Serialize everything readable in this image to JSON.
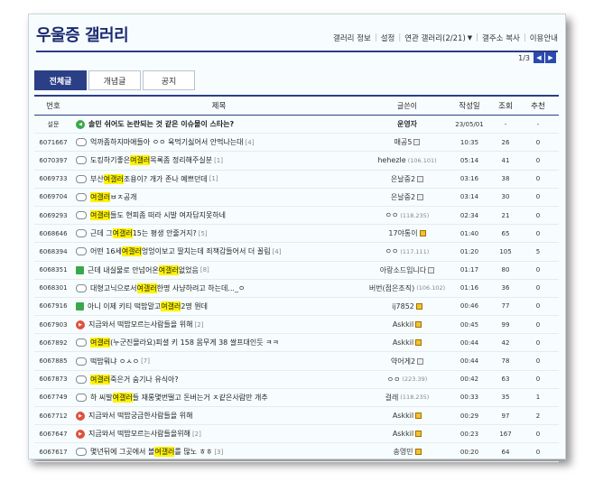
{
  "gallery": {
    "title": "우울증 갤러리"
  },
  "nav": {
    "items": [
      {
        "label": "갤러리 정보"
      },
      {
        "label": "설정"
      },
      {
        "label": "연관 갤러리(2/21)",
        "has_dropdown": true
      },
      {
        "label": "갤주소 복사"
      },
      {
        "label": "이용안내"
      }
    ]
  },
  "pager": {
    "text": "1/3",
    "prev_icon": "triangle-left",
    "next_icon": "triangle-right"
  },
  "tabs": [
    {
      "label": "전체글",
      "active": true
    },
    {
      "label": "개념글",
      "active": false
    },
    {
      "label": "공지",
      "active": false
    }
  ],
  "columns": {
    "no": "번호",
    "title": "제목",
    "user": "글쓴이",
    "date": "작성일",
    "views": "조회",
    "rec": "추천"
  },
  "colors": {
    "accent": "#2b3f87",
    "highlight": "#fff200",
    "speaker": "#3aa84a",
    "play": "#e0503c"
  },
  "rows": [
    {
      "no": "설문",
      "icon": "speaker",
      "parts": [
        "솔민 쉬어도 논란되는 것 같은 이슈몰이 스타는?"
      ],
      "count": "",
      "user": "운영자",
      "ip": "",
      "badge": "",
      "date": "23/05/01",
      "views": "-",
      "rec": "-",
      "notice": true
    },
    {
      "no": "6071667",
      "icon": "chat",
      "parts": [
        "억까좀하지마애들아 ㅇㅇ 육먹기싫어서 안먹나는대"
      ],
      "count": "[4]",
      "user": "매공5",
      "ip": "",
      "badge": "gray",
      "date": "10:35",
      "views": "26",
      "rec": "0"
    },
    {
      "no": "6070397",
      "icon": "chat",
      "parts": [
        "도킹하기좋은",
        "여갤러",
        "목록좀 정리해주실분"
      ],
      "count": "[1]",
      "user": "hehezle",
      "ip": "(106.101)",
      "badge": "",
      "date": "05:14",
      "views": "41",
      "rec": "0"
    },
    {
      "no": "6069733",
      "icon": "chat",
      "parts": [
        "부산",
        "여갤러",
        " 조용이? 개가 존나 예쁘던데"
      ],
      "count": "[1]",
      "user": "은날중2",
      "ip": "",
      "badge": "gray",
      "date": "03:16",
      "views": "38",
      "rec": "0"
    },
    {
      "no": "6069704",
      "icon": "chat",
      "parts": [
        "",
        "여갤러",
        " ㅂㅈ공개"
      ],
      "count": "",
      "user": "은날중2",
      "ip": "",
      "badge": "gray",
      "date": "03:14",
      "views": "30",
      "rec": "0"
    },
    {
      "no": "6069293",
      "icon": "chat",
      "parts": [
        "",
        "여갤러",
        "들도 현피좀 떠라 시발 여자답지못하네"
      ],
      "count": "",
      "user": "ㅇㅇ",
      "ip": "(118.235)",
      "badge": "",
      "date": "02:34",
      "views": "21",
      "rec": "0"
    },
    {
      "no": "6068646",
      "icon": "chat",
      "parts": [
        "근데 그 ",
        "여갤러",
        " 15는 평생 안줄거지?"
      ],
      "count": "[5]",
      "user": "17야통이",
      "ip": "",
      "badge": "gold",
      "date": "01:40",
      "views": "65",
      "rec": "0"
    },
    {
      "no": "6068394",
      "icon": "chat",
      "parts": [
        "어떤 16세",
        "여갤러",
        " 엉엉이보고 딸치는데 죄책감들어서 더 꼴림"
      ],
      "count": "[4]",
      "user": "ㅇㅇ",
      "ip": "(117.111)",
      "badge": "",
      "date": "01:20",
      "views": "105",
      "rec": "5"
    },
    {
      "no": "6068351",
      "icon": "photo",
      "parts": [
        "근데 내실물로 안넘어온 ",
        "여갤러",
        "없었음"
      ],
      "count": "[8]",
      "user": "아랑소드입니다",
      "ip": "",
      "badge": "gray",
      "date": "01:17",
      "views": "80",
      "rec": "0"
    },
    {
      "no": "6068301",
      "icon": "chat",
      "parts": [
        "대형고닉으로서 ",
        "여갤러",
        " 한명 사냥하려고 하는데..._ㅇ"
      ],
      "count": "",
      "user": "버번(점은조직)",
      "ip": "(106.102)",
      "badge": "",
      "date": "01:16",
      "views": "36",
      "rec": "0"
    },
    {
      "no": "6067916",
      "icon": "photo",
      "parts": [
        "아니 이제 키티 떡밥말고 ",
        "여갤러",
        " 2명 뭔데"
      ],
      "count": "",
      "user": "ij7852",
      "ip": "",
      "badge": "gold",
      "date": "00:46",
      "views": "77",
      "rec": "0"
    },
    {
      "no": "6067903",
      "icon": "play",
      "parts": [
        "지금와서 떡밥모르는사람들을 위해"
      ],
      "count": "[2]",
      "user": "Askkil",
      "ip": "",
      "badge": "gold",
      "date": "00:45",
      "views": "99",
      "rec": "0"
    },
    {
      "no": "6067892",
      "icon": "chat",
      "parts": [
        "",
        "여갤러",
        "(누군진몰라요)피셜 키 158 몸무게 38 쌀프대인듯 ㅋㅋ"
      ],
      "count": "",
      "user": "Askkil",
      "ip": "",
      "badge": "gold",
      "date": "00:44",
      "views": "42",
      "rec": "0"
    },
    {
      "no": "6067885",
      "icon": "chat",
      "parts": [
        "떡밥뭐냐 ㅇㅅㅇ"
      ],
      "count": "[7]",
      "user": "약어게2",
      "ip": "",
      "badge": "gray",
      "date": "00:44",
      "views": "78",
      "rec": "0"
    },
    {
      "no": "6067873",
      "icon": "chat",
      "parts": [
        "",
        "여갤러",
        " 죽은거 숨기나 유식아?"
      ],
      "count": "",
      "user": "ㅇㅇ",
      "ip": "(223.39)",
      "badge": "",
      "date": "00:42",
      "views": "63",
      "rec": "0"
    },
    {
      "no": "6067749",
      "icon": "chat",
      "parts": [
        "하 씨발 ",
        "여갤러",
        "들 재롱몇번떨고 돈버는거 ㅈ같은사람만 개추"
      ],
      "count": "",
      "user": "걸레",
      "ip": "(118.235)",
      "badge": "",
      "date": "00:33",
      "views": "35",
      "rec": "1"
    },
    {
      "no": "6067712",
      "icon": "play",
      "parts": [
        "지금와서 떡밥궁금한사람들을 위해"
      ],
      "count": "",
      "user": "Askkil",
      "ip": "",
      "badge": "gold",
      "date": "00:29",
      "views": "97",
      "rec": "2"
    },
    {
      "no": "6067647",
      "icon": "play",
      "parts": [
        "지금와서 떡밥모르는사람들을위해"
      ],
      "count": "[2]",
      "user": "Askkil",
      "ip": "",
      "badge": "gold",
      "date": "00:23",
      "views": "167",
      "rec": "0"
    },
    {
      "no": "6067617",
      "icon": "chat",
      "parts": [
        "몇년뒤에 그곳에서 볼 ",
        "여갤러",
        "를 많노 ㅎㅎ"
      ],
      "count": "[3]",
      "user": "송영민",
      "ip": "",
      "badge": "gold",
      "date": "00:20",
      "views": "64",
      "rec": "0"
    }
  ]
}
